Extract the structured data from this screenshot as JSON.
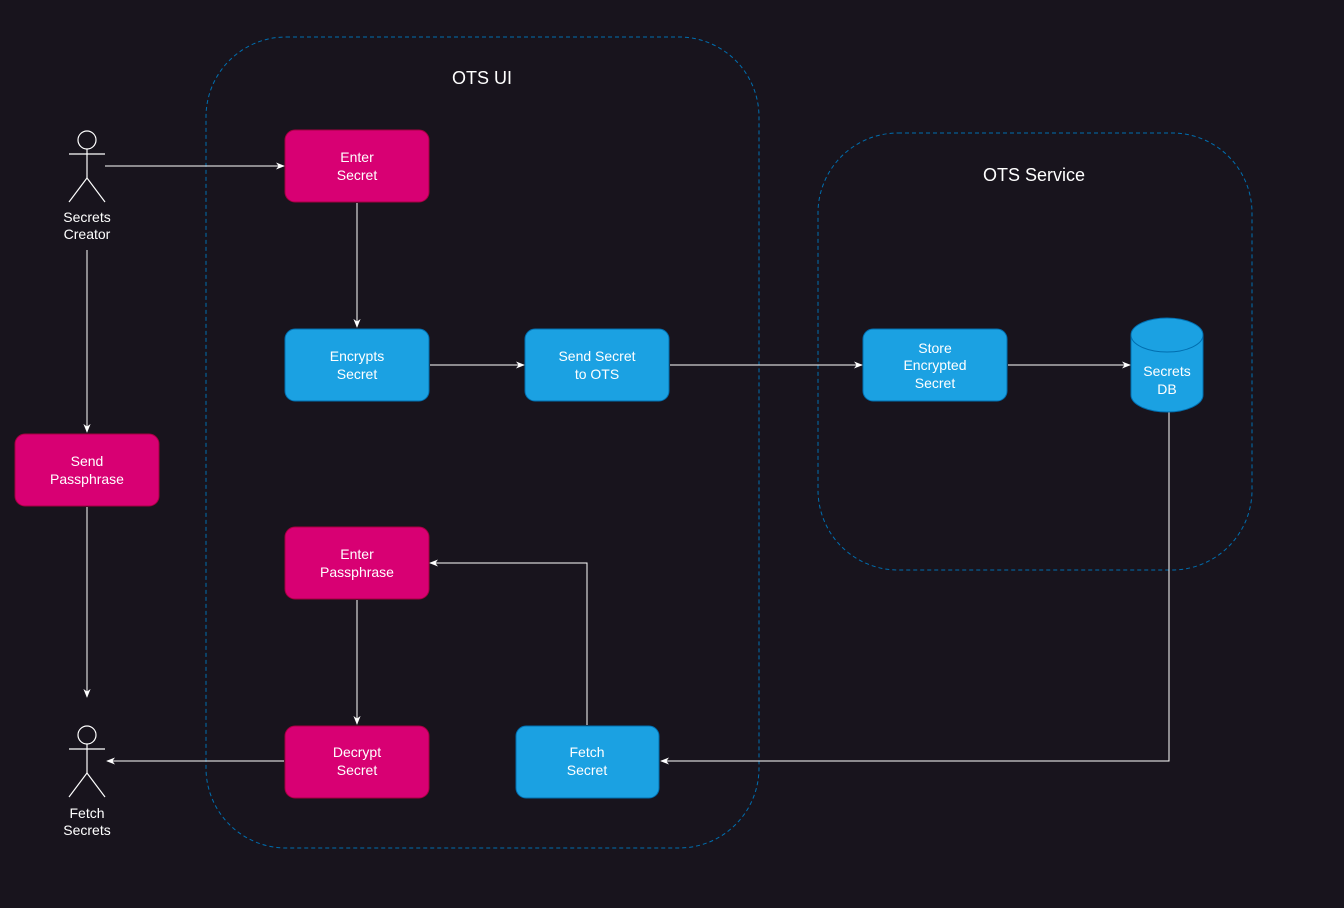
{
  "colors": {
    "background": "#18141d",
    "pink": "#d80073",
    "pink_border": "#a50040",
    "blue": "#1ba1e2",
    "blue_border": "#006eaf",
    "container_border": "#006eaf",
    "edge": "#ffffff",
    "text": "#ffffff"
  },
  "containers": {
    "ots_ui": {
      "title": "OTS UI"
    },
    "ots_service": {
      "title": "OTS Service"
    }
  },
  "actors": {
    "creator": {
      "lines": [
        "Secrets",
        "Creator"
      ]
    },
    "fetcher": {
      "lines": [
        "Fetch",
        "Secrets"
      ]
    }
  },
  "nodes": {
    "enter_secret": {
      "lines": [
        "Enter",
        "Secret"
      ],
      "color": "pink"
    },
    "encrypts_secret": {
      "lines": [
        "Encrypts",
        "Secret"
      ],
      "color": "blue"
    },
    "send_secret": {
      "lines": [
        "Send Secret",
        "to OTS"
      ],
      "color": "blue"
    },
    "store_secret": {
      "lines": [
        "Store",
        "Encrypted",
        "Secret"
      ],
      "color": "blue"
    },
    "secrets_db": {
      "lines": [
        "Secrets",
        "DB"
      ],
      "color": "blue"
    },
    "send_passphrase": {
      "lines": [
        "Send",
        "Passphrase"
      ],
      "color": "pink"
    },
    "enter_passphrase": {
      "lines": [
        "Enter",
        "Passphrase"
      ],
      "color": "pink"
    },
    "decrypt_secret": {
      "lines": [
        "Decrypt",
        "Secret"
      ],
      "color": "pink"
    },
    "fetch_secret": {
      "lines": [
        "Fetch",
        "Secret"
      ],
      "color": "blue"
    }
  },
  "edges": [
    {
      "from": "creator",
      "to": "enter_secret"
    },
    {
      "from": "enter_secret",
      "to": "encrypts_secret"
    },
    {
      "from": "encrypts_secret",
      "to": "send_secret"
    },
    {
      "from": "send_secret",
      "to": "store_secret"
    },
    {
      "from": "store_secret",
      "to": "secrets_db"
    },
    {
      "from": "secrets_db",
      "to": "fetch_secret"
    },
    {
      "from": "fetch_secret",
      "to": "enter_passphrase"
    },
    {
      "from": "enter_passphrase",
      "to": "decrypt_secret"
    },
    {
      "from": "decrypt_secret",
      "to": "fetcher"
    },
    {
      "from": "creator",
      "to": "send_passphrase"
    },
    {
      "from": "send_passphrase",
      "to": "fetcher"
    }
  ]
}
